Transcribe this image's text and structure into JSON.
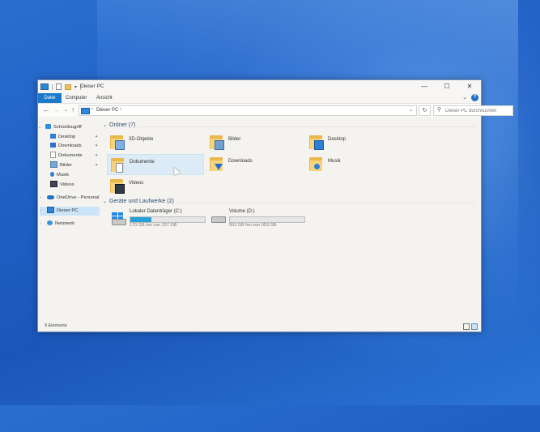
{
  "window": {
    "title": "Dieser PC",
    "controls": {
      "minimize": "—",
      "maximize": "☐",
      "close": "✕"
    }
  },
  "ribbon": {
    "tabs": [
      {
        "label": "Datei"
      },
      {
        "label": "Computer"
      },
      {
        "label": "Ansicht"
      }
    ],
    "help": "?"
  },
  "address": {
    "breadcrumb": "Dieser PC",
    "search_placeholder": "Dieser PC durchsuchen"
  },
  "sidebar": {
    "items": [
      {
        "label": "Schnellzugriff",
        "icon": "star-icon"
      },
      {
        "label": "Desktop",
        "icon": "desktop-icon"
      },
      {
        "label": "Downloads",
        "icon": "downloads-icon"
      },
      {
        "label": "Dokumente",
        "icon": "documents-icon"
      },
      {
        "label": "Bilder",
        "icon": "pictures-icon"
      },
      {
        "label": "Musik",
        "icon": "music-icon"
      },
      {
        "label": "Videos",
        "icon": "videos-icon"
      },
      {
        "label": "OneDrive - Personal",
        "icon": "onedrive-icon"
      },
      {
        "label": "Dieser PC",
        "icon": "this-pc-icon",
        "selected": true
      },
      {
        "label": "Netzwerk",
        "icon": "network-icon"
      }
    ]
  },
  "content": {
    "folders_header": "Ordner (7)",
    "folders": [
      {
        "label": "3D-Objekte"
      },
      {
        "label": "Bilder"
      },
      {
        "label": "Desktop"
      },
      {
        "label": "Dokumente"
      },
      {
        "label": "Downloads"
      },
      {
        "label": "Musik"
      },
      {
        "label": "Videos"
      }
    ],
    "drives_header": "Geräte und Laufwerke (2)",
    "drives": [
      {
        "label": "Lokaler Datenträger (C:)",
        "free": "170 GB frei von 237 GB",
        "used_fraction": 0.28
      },
      {
        "label": "Volume (D:)",
        "free": "953 GB frei von 953 GB",
        "used_fraction": 0.0
      }
    ]
  },
  "status": {
    "count": "9 Elemente"
  },
  "colors": {
    "accent": "#1979ca",
    "selection": "#cce4f7",
    "drive_bar": "#26a0da",
    "folder": "#f6d37c"
  }
}
